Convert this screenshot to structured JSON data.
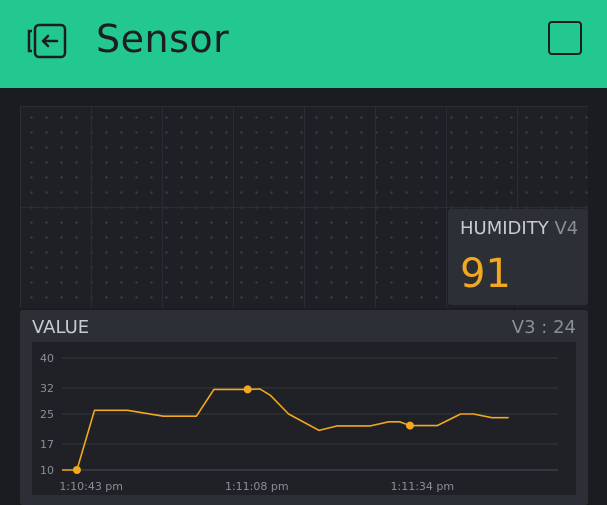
{
  "header": {
    "title": "Sensor",
    "background_color": "#23c890",
    "back_icon": "exit-arrow-icon",
    "action_icon": "square-icon"
  },
  "humidity_widget": {
    "label": "HUMIDITY",
    "pin": "V4",
    "value": "91",
    "value_color": "#f2a81f"
  },
  "value_widget": {
    "label": "VALUE",
    "pin": "V3",
    "separator": ":",
    "current_value": "24"
  },
  "chart_data": {
    "type": "line",
    "series_color": "#f2a81f",
    "ylim": [
      10,
      40
    ],
    "yticks": [
      40,
      32,
      25,
      17,
      10
    ],
    "xticks": [
      {
        "t": 4.5,
        "label": "1:10:43 pm"
      },
      {
        "t": 30.0,
        "label": "1:11:08 pm"
      },
      {
        "t": 55.5,
        "label": "1:11:34 pm"
      }
    ],
    "grid": true,
    "x": [
      0,
      2.3,
      5.0,
      10.1,
      15.6,
      20.7,
      23.4,
      28.6,
      30.5,
      32.1,
      34.9,
      39.6,
      42.4,
      47.5,
      50.3,
      52.0,
      53.6,
      56.0,
      57.8,
      61.4,
      63.4,
      66.2,
      68.8
    ],
    "values": [
      10,
      10,
      26,
      26,
      24.4,
      24.4,
      31.6,
      31.6,
      31.7,
      30,
      25,
      20.6,
      21.8,
      21.8,
      22.9,
      22.9,
      21.9,
      21.9,
      21.9,
      25,
      25,
      24,
      24
    ],
    "markers": [
      {
        "x": 2.3,
        "y": 10
      },
      {
        "x": 28.6,
        "y": 31.6
      },
      {
        "x": 53.6,
        "y": 21.9
      }
    ]
  }
}
